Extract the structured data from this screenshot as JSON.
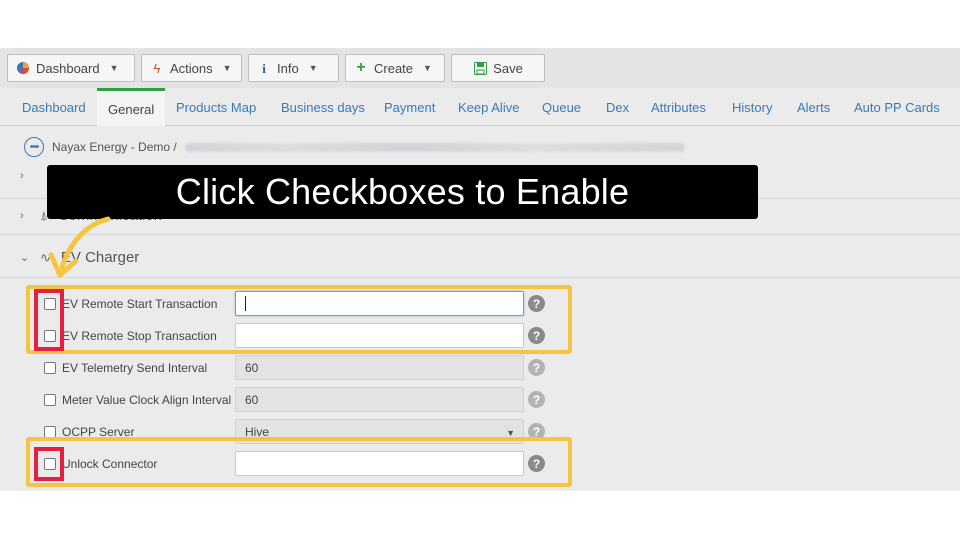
{
  "toolbar": {
    "dashboard_label": "Dashboard",
    "actions_label": "Actions",
    "info_label": "Info",
    "create_label": "Create",
    "save_label": "Save"
  },
  "tabs": [
    {
      "label": "Dashboard"
    },
    {
      "label": "General"
    },
    {
      "label": "Products Map"
    },
    {
      "label": "Business days"
    },
    {
      "label": "Payment"
    },
    {
      "label": "Keep Alive"
    },
    {
      "label": "Queue"
    },
    {
      "label": "Dex"
    },
    {
      "label": "Attributes"
    },
    {
      "label": "History"
    },
    {
      "label": "Alerts"
    },
    {
      "label": "Auto PP Cards"
    }
  ],
  "breadcrumb": {
    "text": "Nayax Energy - Demo /"
  },
  "sections": {
    "communication": "Communication",
    "ev_charger": "EV Charger"
  },
  "form": {
    "rows": [
      {
        "label": "EV Remote Start Transaction",
        "value": ""
      },
      {
        "label": "EV Remote Stop Transaction",
        "value": ""
      },
      {
        "label": "EV Telemetry Send Interval",
        "value": "60"
      },
      {
        "label": "Meter Value Clock Align Interval",
        "value": "60"
      },
      {
        "label": "OCPP Server",
        "value": "Hive"
      },
      {
        "label": "Unlock Connector",
        "value": ""
      }
    ],
    "help_glyph": "?"
  },
  "annotation": {
    "banner_text": "Click Checkboxes to Enable",
    "highlight_color": "#f5c542",
    "checkbox_marker_color": "#e5203f"
  },
  "colors": {
    "link": "#3a79b8",
    "active_tab_accent": "#2f9e44"
  }
}
